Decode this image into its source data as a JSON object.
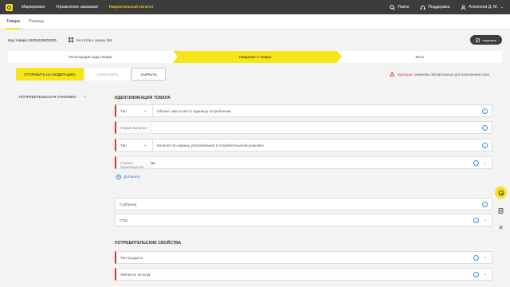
{
  "topbar": {
    "nav": [
      "Маркировка",
      "Управление заказами",
      "Национальный каталог"
    ],
    "active_index": 2,
    "search": "Поиск",
    "support": "Поддержка",
    "user": "Алексеев Д. М."
  },
  "subnav": {
    "tabs": [
      "Товары",
      "Помощь"
    ],
    "active_index": 0
  },
  "header": {
    "product_code": "Код товара 04034229002305",
    "status": "Не готов к заказу КМ",
    "drafts_button": "черновик"
  },
  "stepper": {
    "steps": [
      "Регистрация кода товара",
      "Сведения о товаре",
      "Фото"
    ],
    "active_index": 1
  },
  "actions": {
    "submit": "ОТПРАВИТЬ НА МОДЕРАЦИЮ",
    "save": "СОХРАНИТЬ",
    "close": "ЗАКРЫТЬ"
  },
  "required_note": {
    "red_word": "Красным",
    "rest": "отмечены обязательные для заполнения поля"
  },
  "sidebar": {
    "item": "ПОТРЕБИТЕЛЬСКАЯ УПАКОВКА"
  },
  "section1": {
    "title": "ИДЕНТИФИКАЦИЯ ТОВАРА",
    "fields": {
      "tip": "Тип",
      "volume": "Объём / масса нетто единицы потребления",
      "release_form": "Форма выпуска",
      "tip2": "Тип",
      "qty": "Количество единиц употребления в потребительской упаковке",
      "country": "Страна производства",
      "country_suffix": "ва",
      "add": "Добавить",
      "subbrand": "Суббренд",
      "stm": "СТМ"
    }
  },
  "section2": {
    "title": "ПОТРЕБИТЕЛЬСКИЕ СВОЙСТВА",
    "fields": {
      "product_type": "Тип продукта",
      "is_bad": "Является ли БАД"
    }
  },
  "colors": {
    "accent": "#f5e51b",
    "required": "#d9342b",
    "info": "#3b8fd8",
    "topbar": "#3c3c3c"
  }
}
